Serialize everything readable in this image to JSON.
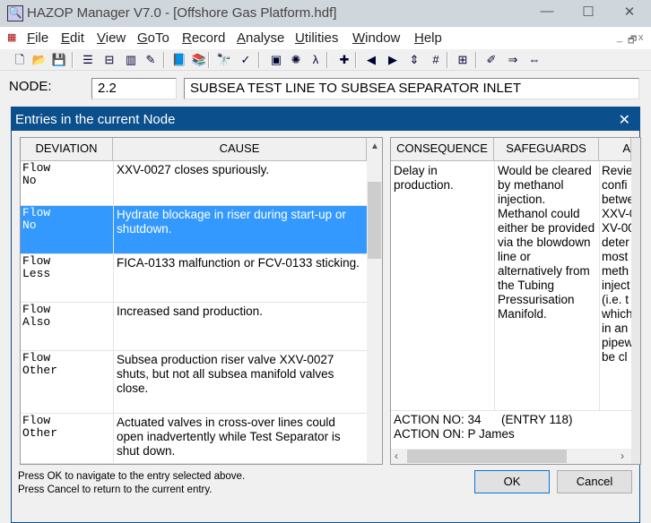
{
  "window": {
    "title": "HAZOP Manager V7.0 - [Offshore Gas Platform.hdf]",
    "minimize": "—",
    "maximize": "☐",
    "close": "✕"
  },
  "menu": [
    {
      "key": "F",
      "rest": "ile"
    },
    {
      "key": "E",
      "rest": "dit"
    },
    {
      "key": "V",
      "rest": "iew"
    },
    {
      "key": "G",
      "rest": "oTo"
    },
    {
      "key": "R",
      "rest": "ecord"
    },
    {
      "key": "A",
      "rest": "nalyse"
    },
    {
      "key": "U",
      "rest": "tilities"
    },
    {
      "key": "W",
      "rest": "indow"
    },
    {
      "key": "H",
      "rest": "elp"
    }
  ],
  "mdi_buttons": [
    "_",
    "🗗",
    "x"
  ],
  "toolbar_icons": [
    "new-icon",
    "open-icon",
    "save-icon",
    "list-icon",
    "table-icon",
    "grid-icon",
    "edit-icon",
    "book-icon",
    "books-icon",
    "find-icon",
    "spellcheck-icon",
    "report-icon",
    "db-link-icon",
    "lambda-db-icon",
    "add-node-icon",
    "prev-icon",
    "next-icon",
    "updown-icon",
    "find-number-icon",
    "insert-icon",
    "highlight-icon",
    "export-icon",
    "swap-icon"
  ],
  "node": {
    "label": "NODE:",
    "number": "2.2",
    "description": "SUBSEA TEST LINE TO SUBSEA SEPARATOR INLET"
  },
  "dialog": {
    "title": "Entries in the current Node",
    "close": "✕",
    "left_headers": [
      "DEVIATION",
      "CAUSE"
    ],
    "entries": [
      {
        "deviation": "Flow\nNo",
        "cause": "XXV-0027 closes spuriously.",
        "selected": false
      },
      {
        "deviation": "Flow\nNo",
        "cause": "Hydrate blockage in riser during start-up or shutdown.",
        "selected": true
      },
      {
        "deviation": "Flow\nLess",
        "cause": "FICA-0133 malfunction or FCV-0133 sticking.",
        "selected": false
      },
      {
        "deviation": "Flow\nAlso",
        "cause": "Increased sand production.",
        "selected": false
      },
      {
        "deviation": "Flow\nOther",
        "cause": "Subsea production riser valve XXV-0027 shuts, but not all subsea manifold valves close.",
        "selected": false
      },
      {
        "deviation": "Flow\nOther",
        "cause": "Actuated valves in cross-over lines could open inadvertently while Test Separator is shut down.",
        "selected": false
      }
    ],
    "right_headers": [
      "CONSEQUENCE",
      "SAFEGUARDS",
      "A"
    ],
    "consequence": "Delay in production.",
    "safeguards": "Would be cleared by methanol injection. Methanol could either be provided via the blowdown line or alternatively from the Tubing Pressurisation Manifold.",
    "action_lines": [
      "Revie",
      "confi",
      "betwe",
      "XXV-0",
      "XV-00",
      "deter",
      "most",
      "meth",
      "inject",
      "(i.e. t",
      "which",
      "in an",
      "pipew",
      "be cl"
    ],
    "action_no": "ACTION NO: 34",
    "entry": "(ENTRY 118)",
    "action_on": "ACTION ON: P James",
    "help1": "Press OK to navigate to the entry selected above.",
    "help2": "Press Cancel to return to the current entry.",
    "ok": "OK",
    "cancel": "Cancel"
  },
  "colors": {
    "selection": "#3399ff",
    "dialog_title": "#0b4f8c"
  }
}
